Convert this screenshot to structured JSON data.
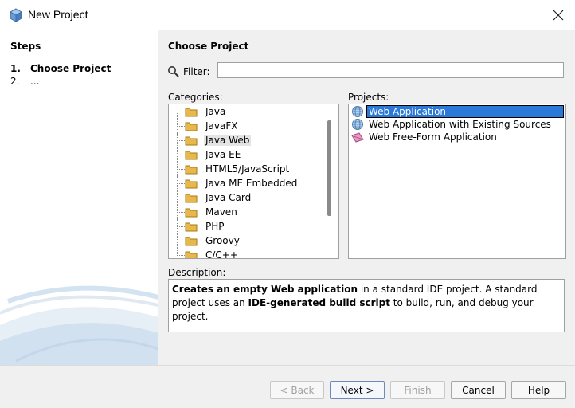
{
  "window": {
    "title": "New Project",
    "close_icon": "close-icon"
  },
  "steps": {
    "header": "Steps",
    "items": [
      {
        "num": "1.",
        "label": "Choose Project",
        "active": true
      },
      {
        "num": "2.",
        "label": "...",
        "active": false
      }
    ]
  },
  "main": {
    "header": "Choose Project",
    "filter_label": "Filter:",
    "filter_value": "",
    "categories_label": "Categories:",
    "projects_label": "Projects:",
    "description_label": "Description:"
  },
  "categories": [
    {
      "label": "Java"
    },
    {
      "label": "JavaFX"
    },
    {
      "label": "Java Web",
      "selected": true
    },
    {
      "label": "Java EE"
    },
    {
      "label": "HTML5/JavaScript"
    },
    {
      "label": "Java ME Embedded"
    },
    {
      "label": "Java Card"
    },
    {
      "label": "Maven"
    },
    {
      "label": "PHP"
    },
    {
      "label": "Groovy"
    },
    {
      "label": "C/C++"
    }
  ],
  "projects": [
    {
      "label": "Web Application",
      "icon": "globe-icon",
      "selected": true
    },
    {
      "label": "Web Application with Existing Sources",
      "icon": "globe-icon"
    },
    {
      "label": "Web Free-Form Application",
      "icon": "freeform-icon"
    }
  ],
  "description": {
    "b1": "Creates an empty Web application",
    "t1": " in a standard IDE project. A standard project uses an ",
    "b2": "IDE-generated build script",
    "t2": " to build, run, and debug your project."
  },
  "buttons": {
    "back": "< Back",
    "next": "Next >",
    "finish": "Finish",
    "cancel": "Cancel",
    "help": "Help"
  },
  "colors": {
    "selection": "#2a78d8",
    "folder": "#e8b84a"
  }
}
